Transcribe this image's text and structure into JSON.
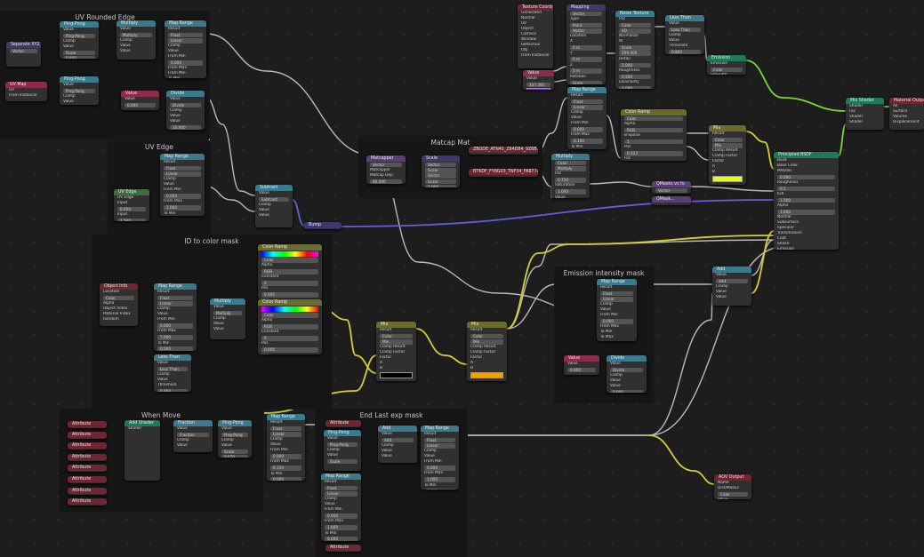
{
  "colors": {
    "bg": "#1d1d1d",
    "frame": "#161616",
    "wire_gray": "#b9b9b9",
    "wire_yellow": "#d6cf33",
    "wire_green": "#7bd63a",
    "wire_purple": "#6060d8"
  },
  "frames": [
    {
      "title": "UV Rounded Edge"
    },
    {
      "title": "UV Edge"
    },
    {
      "title": "ID to color mask"
    },
    {
      "title": "When Move"
    },
    {
      "title": "End Last exp mask"
    },
    {
      "title": "Matcap Mat"
    },
    {
      "title": "Emission intensity mask"
    }
  ],
  "nodes": {
    "sep_xyz": {
      "title": "Separate XYZ",
      "rows": [
        "Vector"
      ]
    },
    "uv_map": {
      "title": "UV Map",
      "rows": [
        "UV",
        "From Instancer"
      ]
    },
    "ping1": {
      "title": "Ping-Pong",
      "rows": [
        "Value",
        "Ping-Pong",
        "Clamp",
        "Value",
        "Scale",
        "0.850"
      ]
    },
    "ping2": {
      "title": "Ping-Pong",
      "rows": [
        "Value",
        "Ping-Pong",
        "Clamp",
        "Value",
        "Scale",
        "0.850"
      ]
    },
    "mult1": {
      "title": "Multiply",
      "rows": [
        "Value",
        "Multiply",
        "Clamp",
        "Value",
        "Value"
      ]
    },
    "mult2": {
      "title": "Multiply",
      "rows": [
        "Value",
        "Multiply",
        "Clamp",
        "Value",
        "Value"
      ]
    },
    "maprange1": {
      "title": "Map Range",
      "rows": [
        "Result",
        "Float",
        "Linear",
        "Clamp",
        "Value",
        "From Min",
        "0.000",
        "From Max",
        "From Min",
        "To Min",
        "0.000",
        "To Max",
        "1.000"
      ]
    },
    "value1": {
      "title": "Value",
      "rows": [
        "Value",
        "0.000"
      ]
    },
    "divide1": {
      "title": "Divide",
      "rows": [
        "Value",
        "Divide",
        "Clamp",
        "Value",
        "Value",
        "10.000"
      ]
    },
    "uvedge": {
      "title": "UV Edge",
      "rows": [
        "UV Edge",
        "Input",
        "0.000",
        "Input",
        "1.500"
      ]
    },
    "maprange2": {
      "title": "Map Range",
      "rows": [
        "Result",
        "Float",
        "Linear",
        "Clamp",
        "Value",
        "From Min",
        "0.000",
        "From Max",
        "1.000",
        "To Min",
        "0.000",
        "To Max",
        "10.000"
      ]
    },
    "subtract": {
      "title": "Subtract",
      "rows": [
        "Value",
        "Subtract",
        "Clamp",
        "Value",
        "Value"
      ]
    },
    "bump": {
      "title": "Bump",
      "rows": []
    },
    "objinfo": {
      "title": "Object Info",
      "rows": [
        "Location",
        "Color",
        "Alpha",
        "Object Index",
        "Material Index",
        "Random"
      ]
    },
    "maprange3": {
      "title": "Map Range",
      "rows": [
        "Result",
        "Float",
        "Linear",
        "Clamp",
        "Value",
        "From Min",
        "0.000",
        "From Max",
        "7.000",
        "To Min",
        "0.000",
        "To Max",
        "1.000"
      ]
    },
    "mult3": {
      "title": "Multiply",
      "rows": [
        "Value",
        "Multiply",
        "Clamp",
        "Value",
        "Value"
      ]
    },
    "lessthan1": {
      "title": "Less Than",
      "rows": [
        "Value",
        "Less Than",
        "Clamp",
        "Value",
        "Threshold",
        "0.950"
      ]
    },
    "colramp1": {
      "title": "Color Ramp",
      "rows": [
        "Color",
        "Alpha",
        "RGB",
        "Constant",
        "0",
        "Pos",
        "0.000",
        "Fac"
      ]
    },
    "colramp2": {
      "title": "Color Ramp",
      "rows": [
        "Color",
        "Alpha",
        "RGB",
        "Constant",
        "0",
        "Pos",
        "0.000",
        "Fac"
      ]
    },
    "mix1": {
      "title": "Mix",
      "rows": [
        "Result",
        "Color",
        "Mix",
        "Clamp Result",
        "Clamp Factor",
        "Factor",
        "A",
        "B"
      ]
    },
    "mix2": {
      "title": "Mix",
      "rows": [
        "Result",
        "Color",
        "Mix",
        "Clamp Result",
        "Clamp Factor",
        "Factor",
        "A",
        "B"
      ]
    },
    "addshader": {
      "title": "Add Shader",
      "rows": [
        "Shader"
      ]
    },
    "fraction": {
      "title": "Fraction",
      "rows": [
        "Value",
        "Fraction",
        "Clamp",
        "Value"
      ]
    },
    "pingpong3": {
      "title": "Ping-Pong",
      "rows": [
        "Value",
        "Ping-Pong",
        "Clamp",
        "Value",
        "Scale",
        "0.670"
      ]
    },
    "maprange4": {
      "title": "Map Range",
      "rows": [
        "Result",
        "Float",
        "Linear",
        "Clamp",
        "Value",
        "From Min",
        "0.000",
        "From Max",
        "0.720",
        "To Min",
        "0.000",
        "To Max",
        "1.000"
      ]
    },
    "attr": {
      "title": "Attribute",
      "rows": []
    },
    "pingpong4": {
      "title": "Ping-Pong",
      "rows": [
        "Value",
        "Ping-Pong",
        "Clamp",
        "Value",
        "Scale"
      ]
    },
    "add1": {
      "title": "Add",
      "rows": [
        "Value",
        "Add",
        "Clamp",
        "Value",
        "Value"
      ]
    },
    "maprange5": {
      "title": "Map Range",
      "rows": [
        "Result",
        "Float",
        "Linear",
        "Clamp",
        "Value",
        "From Min",
        "0.000",
        "From Max",
        "1.000",
        "To Min",
        "0.000",
        "To Max",
        "1.000"
      ]
    },
    "maprange6": {
      "title": "Map Range",
      "rows": [
        "Result",
        "Float",
        "Linear",
        "Clamp",
        "Value",
        "From Min",
        "0.000",
        "From Max",
        "1.000",
        "To Min",
        "0.000",
        "To Max",
        "1.000"
      ]
    },
    "matcap": {
      "title": "Matcapper",
      "rows": [
        "Vector",
        "Matcapper",
        "Matcap Dep",
        "90.000"
      ]
    },
    "scale": {
      "title": "Scale",
      "rows": [
        "Vector",
        "Scale",
        "Vector",
        "Scale",
        "1.000"
      ]
    },
    "img1": {
      "title": "ZBODE_ATN41_Z64D84_9Z6B7E.png",
      "rows": []
    },
    "img2": {
      "title": "BT6DF_FY8G03_TNF34_FA8778.png",
      "rows": []
    },
    "texcoord": {
      "title": "Texture Coordinate",
      "rows": [
        "Generated",
        "Normal",
        "UV",
        "Object",
        "Camera",
        "Window",
        "Reflection",
        "Obj",
        "From Instancer"
      ]
    },
    "mapping": {
      "title": "Mapping",
      "rows": [
        "Vector",
        "Type",
        "Point",
        "Vector",
        "Location",
        "X",
        "0 m",
        "Y",
        "0 m",
        "Z",
        "0 m",
        "Rotation",
        "Scale",
        "X",
        "1.000",
        "Y",
        "1.000",
        "Z",
        "0.840"
      ]
    },
    "value2": {
      "title": "Value",
      "rows": [
        "Value",
        "337.391"
      ]
    },
    "noise": {
      "title": "Noise Texture",
      "rows": [
        "Fac",
        "Color",
        "4D",
        "Normalize",
        "W",
        "Scale",
        "599.400",
        "Detail",
        "2.000",
        "Roughness",
        "0.500",
        "Lacunarity",
        "2.000",
        "Distortion",
        "0.000"
      ]
    },
    "lessthan2": {
      "title": "Less Than",
      "rows": [
        "Value",
        "Less Than",
        "Clamp",
        "Value",
        "Threshold",
        "0.800"
      ]
    },
    "emission": {
      "title": "Emission",
      "rows": [
        "Emission",
        "Color",
        "Strength",
        "2.000"
      ]
    },
    "maprange7": {
      "title": "Map Range",
      "rows": [
        "Result",
        "Float",
        "Linear",
        "Clamp",
        "Value",
        "From Min",
        "0.000",
        "From Max",
        "0.100",
        "To Min",
        "0.000",
        "To Max",
        "1.000"
      ]
    },
    "colramp3": {
      "title": "Color Ramp",
      "rows": [
        "Color",
        "Alpha",
        "RGB",
        "B-Spline",
        "1",
        "Pos",
        "0.323",
        "Fac"
      ]
    },
    "bsdfmult": {
      "title": "Multiply",
      "rows": [
        "Color",
        "Multiply",
        "Fac",
        "0.710",
        "Saturation",
        "1.000",
        "Value",
        "2.000",
        "Color",
        "1.000"
      ]
    },
    "mix3": {
      "title": "Mix",
      "rows": [
        "Result",
        "Color",
        "Mix",
        "Clamp Result",
        "Clamp Factor",
        "Factor",
        "A",
        "B"
      ]
    },
    "qmasks": {
      "title": "QMasks vs fo",
      "rows": [
        "Vector",
        "Dist"
      ]
    },
    "qmask2": {
      "title": "QMask...",
      "rows": []
    },
    "principled": {
      "title": "Principled BSDF",
      "rows": [
        "BSDF",
        "Base Color",
        "Metallic",
        "0.000",
        "Roughness",
        "0.5",
        "IOR",
        "1.500",
        "Alpha",
        "1.000",
        "Normal",
        "Subsurface",
        "Specular",
        "Transmission",
        "Coat",
        "Sheen",
        "Emission",
        "Color",
        "Strength"
      ]
    },
    "mixshader": {
      "title": "Mix Shader",
      "rows": [
        "Shader",
        "Fac",
        "Shader",
        "Shader"
      ]
    },
    "matout": {
      "title": "Material Output",
      "rows": [
        "All",
        "Surface",
        "Volume",
        "Displacement"
      ]
    },
    "maprange8": {
      "title": "Map Range",
      "rows": [
        "Result",
        "Float",
        "Linear",
        "Clamp",
        "Value",
        "From Min",
        "0.000",
        "From Max",
        "To Min",
        "To Max"
      ]
    },
    "value3": {
      "title": "Value",
      "rows": [
        "Value",
        "0.000"
      ]
    },
    "divide2": {
      "title": "Divide",
      "rows": [
        "Value",
        "Divide",
        "Clamp",
        "Value",
        "Value",
        "0.000"
      ]
    },
    "add2": {
      "title": "Add",
      "rows": [
        "Value",
        "Add",
        "Clamp",
        "Value",
        "Value"
      ]
    },
    "aov": {
      "title": "AOV Output",
      "rows": [
        "Name",
        "Dist/Mask3",
        "Color",
        "Value",
        "0.000"
      ]
    }
  },
  "attributes": [
    "Attribute",
    "Attribute",
    "Attribute",
    "Attribute",
    "Attribute",
    "Attribute",
    "Attribute",
    "Attribute"
  ],
  "end_attr": "Attribute"
}
